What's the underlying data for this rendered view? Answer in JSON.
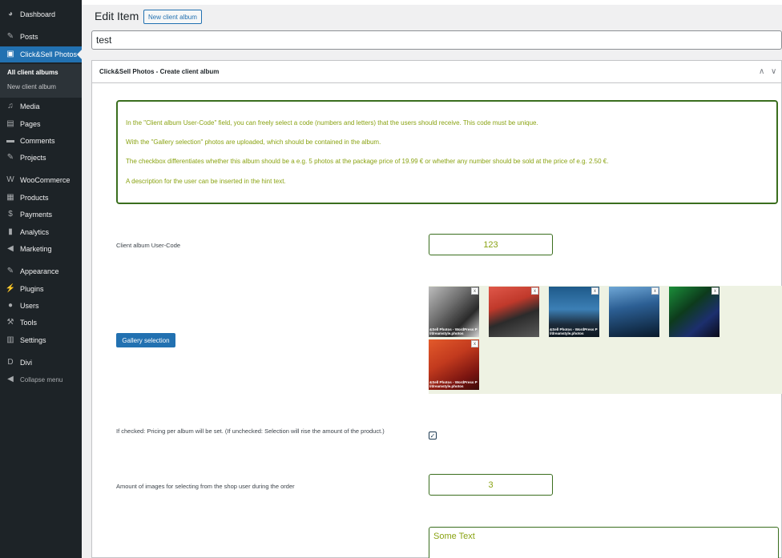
{
  "sidebar": {
    "items": [
      {
        "label": "Dashboard",
        "icon": "dashboard-icon",
        "glyph": "◕"
      },
      {
        "label": "Posts",
        "icon": "pin-icon",
        "glyph": "✎"
      },
      {
        "label": "Click&Sell Photos",
        "icon": "camera-icon",
        "glyph": "▣"
      },
      {
        "label": "Media",
        "icon": "media-icon",
        "glyph": "♫"
      },
      {
        "label": "Pages",
        "icon": "pages-icon",
        "glyph": "▤"
      },
      {
        "label": "Comments",
        "icon": "comments-icon",
        "glyph": "▬"
      },
      {
        "label": "Projects",
        "icon": "pin-icon",
        "glyph": "✎"
      },
      {
        "label": "WooCommerce",
        "icon": "woo-icon",
        "glyph": "W"
      },
      {
        "label": "Products",
        "icon": "products-icon",
        "glyph": "▦"
      },
      {
        "label": "Payments",
        "icon": "payments-icon",
        "glyph": "$"
      },
      {
        "label": "Analytics",
        "icon": "analytics-icon",
        "glyph": "▮"
      },
      {
        "label": "Marketing",
        "icon": "megaphone-icon",
        "glyph": "◀"
      },
      {
        "label": "Appearance",
        "icon": "brush-icon",
        "glyph": "✎"
      },
      {
        "label": "Plugins",
        "icon": "plugin-icon",
        "glyph": "⚡"
      },
      {
        "label": "Users",
        "icon": "users-icon",
        "glyph": "●"
      },
      {
        "label": "Tools",
        "icon": "wrench-icon",
        "glyph": "⚒"
      },
      {
        "label": "Settings",
        "icon": "settings-icon",
        "glyph": "▥"
      },
      {
        "label": "Divi",
        "icon": "divi-icon",
        "glyph": "D"
      },
      {
        "label": "Collapse menu",
        "icon": "collapse-icon",
        "glyph": "◀"
      }
    ],
    "submenu": [
      "All client albums",
      "New client album"
    ]
  },
  "header": {
    "title": "Edit Item",
    "new_button": "New client album"
  },
  "title_input": {
    "value": "test"
  },
  "metabox": {
    "title": "Click&Sell Photos - Create client album",
    "arrows": [
      "∧",
      "∨"
    ],
    "info": [
      "In the \"Client album User-Code\" field, you can freely select a code (numbers and letters) that the users should receive. This code must be unique.",
      "With the \"Gallery selection\" photos are uploaded, which should be contained in the album.",
      "The checkbox differentiates whether this album should be a e.g. 5 photos at the package price of 19.99 € or whether any number should be sold at the price of e.g. 2.50 €.",
      "A description for the user can be inserted in the hint text."
    ],
    "fields": {
      "user_code_label": "Client album User-Code",
      "user_code_value": "123",
      "gallery_button": "Gallery selection",
      "pricing_label": "If checked: Pricing per album will be set. (If unchecked: Selection will rise the amount of the product.)",
      "pricing_checked": "✓",
      "amount_label": "Amount of images for selecting from the shop user during the order",
      "amount_value": "3",
      "hint_value": "Some Text"
    },
    "thumbnails": [
      {
        "caption1": "&Sell Photos - WordPress P",
        "caption2": "//dreamstyle.photos"
      },
      {
        "caption1": "",
        "caption2": ""
      },
      {
        "caption1": "&Sell Photos - WordPress P",
        "caption2": "//dreamstyle.photos"
      },
      {
        "caption1": "",
        "caption2": ""
      },
      {
        "caption1": "",
        "caption2": ""
      },
      {
        "caption1": "&Sell Photos - WordPress P",
        "caption2": "//dreamstyle.photos"
      }
    ],
    "thumb_remove": "x"
  },
  "colors": {
    "accent": "#2271b1",
    "sidebar": "#1d2327",
    "green_border": "#3a6e1e",
    "green_text": "#8aa313"
  }
}
